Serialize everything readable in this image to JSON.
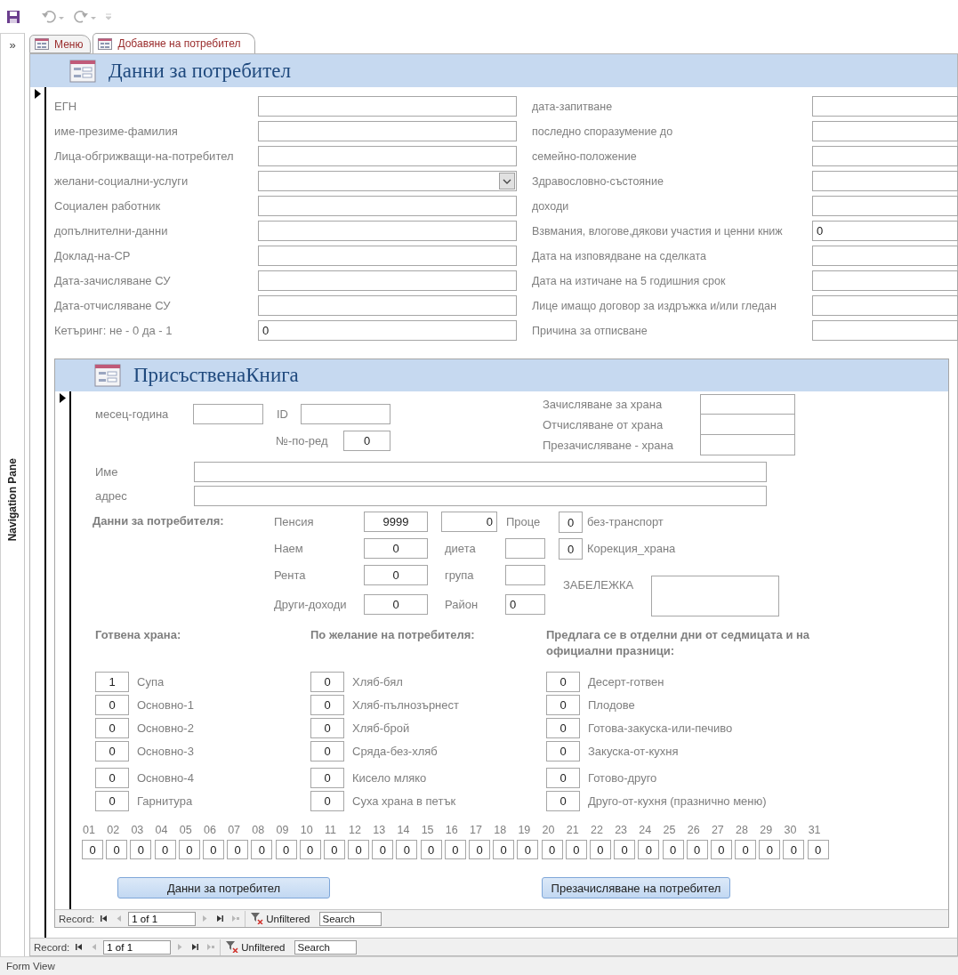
{
  "navigation_pane": {
    "toggle": "»",
    "label": "Navigation Pane"
  },
  "tabs": [
    {
      "label": "Меню",
      "selected": false
    },
    {
      "label": "Добавяне на потребител",
      "selected": true
    }
  ],
  "form": {
    "title": "Данни за потребител",
    "left_fields": [
      {
        "label": "ЕГН",
        "kind": "text"
      },
      {
        "label": "име-презиме-фамилия",
        "kind": "text"
      },
      {
        "label": "Лица-обгрижващи-на-потребител",
        "kind": "text"
      },
      {
        "label": "желани-социални-услуги",
        "kind": "dropdown"
      },
      {
        "label": "Социален работник",
        "kind": "text"
      },
      {
        "label": "допълнителни-данни",
        "kind": "text"
      },
      {
        "label": "Доклад-на-СР",
        "kind": "text"
      },
      {
        "label": "Дата-зачисляване СУ",
        "kind": "text"
      },
      {
        "label": "Дата-отчисляване СУ",
        "kind": "text"
      },
      {
        "label": "Кетъринг: не - 0  да - 1",
        "kind": "text",
        "value": "0"
      }
    ],
    "right_fields": [
      {
        "label": "дата-запитване",
        "kind": "text"
      },
      {
        "label": "последно споразумение до",
        "kind": "text"
      },
      {
        "label": "семейно-положение",
        "kind": "text"
      },
      {
        "label": "Здравословно-състояние",
        "kind": "text"
      },
      {
        "label": "доходи",
        "kind": "text"
      },
      {
        "label": "Взвмания, влогове,дякови участия и ценни книж",
        "kind": "text",
        "value": "0"
      },
      {
        "label": "Дата на изповядване на сделката",
        "kind": "text"
      },
      {
        "label": "Дата на изтичане на 5 годишния срок",
        "kind": "text"
      },
      {
        "label": "Лице имащо договор за издръжка и/или гледан",
        "kind": "text"
      },
      {
        "label": "Причина за отписване",
        "kind": "text"
      }
    ],
    "record_nav": {
      "label": "Record:",
      "position": "1 of 1",
      "filter": "Unfiltered",
      "search": {
        "placeholder": "Search"
      }
    }
  },
  "subform": {
    "title": "ПрисъственаКнига",
    "month": {
      "label": "месец-година"
    },
    "id": {
      "label": "ID"
    },
    "order": {
      "label": "№-по-ред",
      "value": "0"
    },
    "food_dates": [
      {
        "label": "Зачисляване за храна"
      },
      {
        "label": "Отчисляване от храна"
      },
      {
        "label": "Презачисляване - храна"
      }
    ],
    "person": [
      {
        "label": "Име"
      },
      {
        "label": "адрес"
      }
    ],
    "income": {
      "heading": "Данни за потребителя:",
      "rows": [
        {
          "label": "Пенсия",
          "value": "9999"
        },
        {
          "label": "Наем",
          "value": "0"
        },
        {
          "label": "Рента",
          "value": "0"
        },
        {
          "label": "Други-доходи",
          "value": "0"
        }
      ]
    },
    "percent": {
      "value": "0",
      "label": "Проце"
    },
    "extras": [
      {
        "label": "диета"
      },
      {
        "label": "група"
      },
      {
        "label": "Район",
        "value": "0"
      }
    ],
    "flags": [
      {
        "value": "0",
        "label": "без-транспорт"
      },
      {
        "value": "0",
        "label": "Корекция_храна"
      }
    ],
    "note": {
      "label": "ЗАБЕЛЕЖКА"
    },
    "meal_groups": [
      {
        "heading": "Готвена храна:",
        "items": [
          {
            "value": "1",
            "label": "Супа"
          },
          {
            "value": "0",
            "label": "Основно-1"
          },
          {
            "value": "0",
            "label": "Основно-2"
          },
          {
            "value": "0",
            "label": "Основно-3"
          },
          {
            "value": "0",
            "label": "Основно-4"
          },
          {
            "value": "0",
            "label": "Гарнитура"
          }
        ]
      },
      {
        "heading": "По желание на потребителя:",
        "items": [
          {
            "value": "0",
            "label": "Хляб-бял"
          },
          {
            "value": "0",
            "label": "Хляб-пълнозърнест"
          },
          {
            "value": "0",
            "label": "Хляб-брой"
          },
          {
            "value": "0",
            "label": "Сряда-без-хляб"
          },
          {
            "value": "0",
            "label": "Кисело мляко"
          },
          {
            "value": "0",
            "label": "Суха храна в петък"
          }
        ]
      },
      {
        "heading": "Предлага се в отделни дни от седмицата и на официални празници:",
        "items": [
          {
            "value": "0",
            "label": "Десерт-готвен"
          },
          {
            "value": "0",
            "label": "Плодове"
          },
          {
            "value": "0",
            "label": "Готова-закуска-или-печиво"
          },
          {
            "value": "0",
            "label": "Закуска-от-кухня"
          },
          {
            "value": "0",
            "label": "Готово-друго"
          },
          {
            "value": "0",
            "label": "Друго-от-кухня (празнично меню)"
          }
        ]
      }
    ],
    "days": [
      {
        "day": "01",
        "value": "0"
      },
      {
        "day": "02",
        "value": "0"
      },
      {
        "day": "03",
        "value": "0"
      },
      {
        "day": "04",
        "value": "0"
      },
      {
        "day": "05",
        "value": "0"
      },
      {
        "day": "06",
        "value": "0"
      },
      {
        "day": "07",
        "value": "0"
      },
      {
        "day": "08",
        "value": "0"
      },
      {
        "day": "09",
        "value": "0"
      },
      {
        "day": "10",
        "value": "0"
      },
      {
        "day": "11",
        "value": "0"
      },
      {
        "day": "12",
        "value": "0"
      },
      {
        "day": "13",
        "value": "0"
      },
      {
        "day": "14",
        "value": "0"
      },
      {
        "day": "15",
        "value": "0"
      },
      {
        "day": "16",
        "value": "0"
      },
      {
        "day": "17",
        "value": "0"
      },
      {
        "day": "18",
        "value": "0"
      },
      {
        "day": "19",
        "value": "0"
      },
      {
        "day": "20",
        "value": "0"
      },
      {
        "day": "21",
        "value": "0"
      },
      {
        "day": "22",
        "value": "0"
      },
      {
        "day": "23",
        "value": "0"
      },
      {
        "day": "24",
        "value": "0"
      },
      {
        "day": "25",
        "value": "0"
      },
      {
        "day": "26",
        "value": "0"
      },
      {
        "day": "27",
        "value": "0"
      },
      {
        "day": "28",
        "value": "0"
      },
      {
        "day": "29",
        "value": "0"
      },
      {
        "day": "30",
        "value": "0"
      },
      {
        "day": "31",
        "value": "0"
      }
    ],
    "buttons": [
      "Данни за потребител",
      "Презачисляване на потребител"
    ],
    "record_nav": {
      "label": "Record:",
      "position": "1 of 1",
      "filter": "Unfiltered",
      "search": {
        "placeholder": "Search"
      }
    }
  },
  "status_bar": "Form View"
}
